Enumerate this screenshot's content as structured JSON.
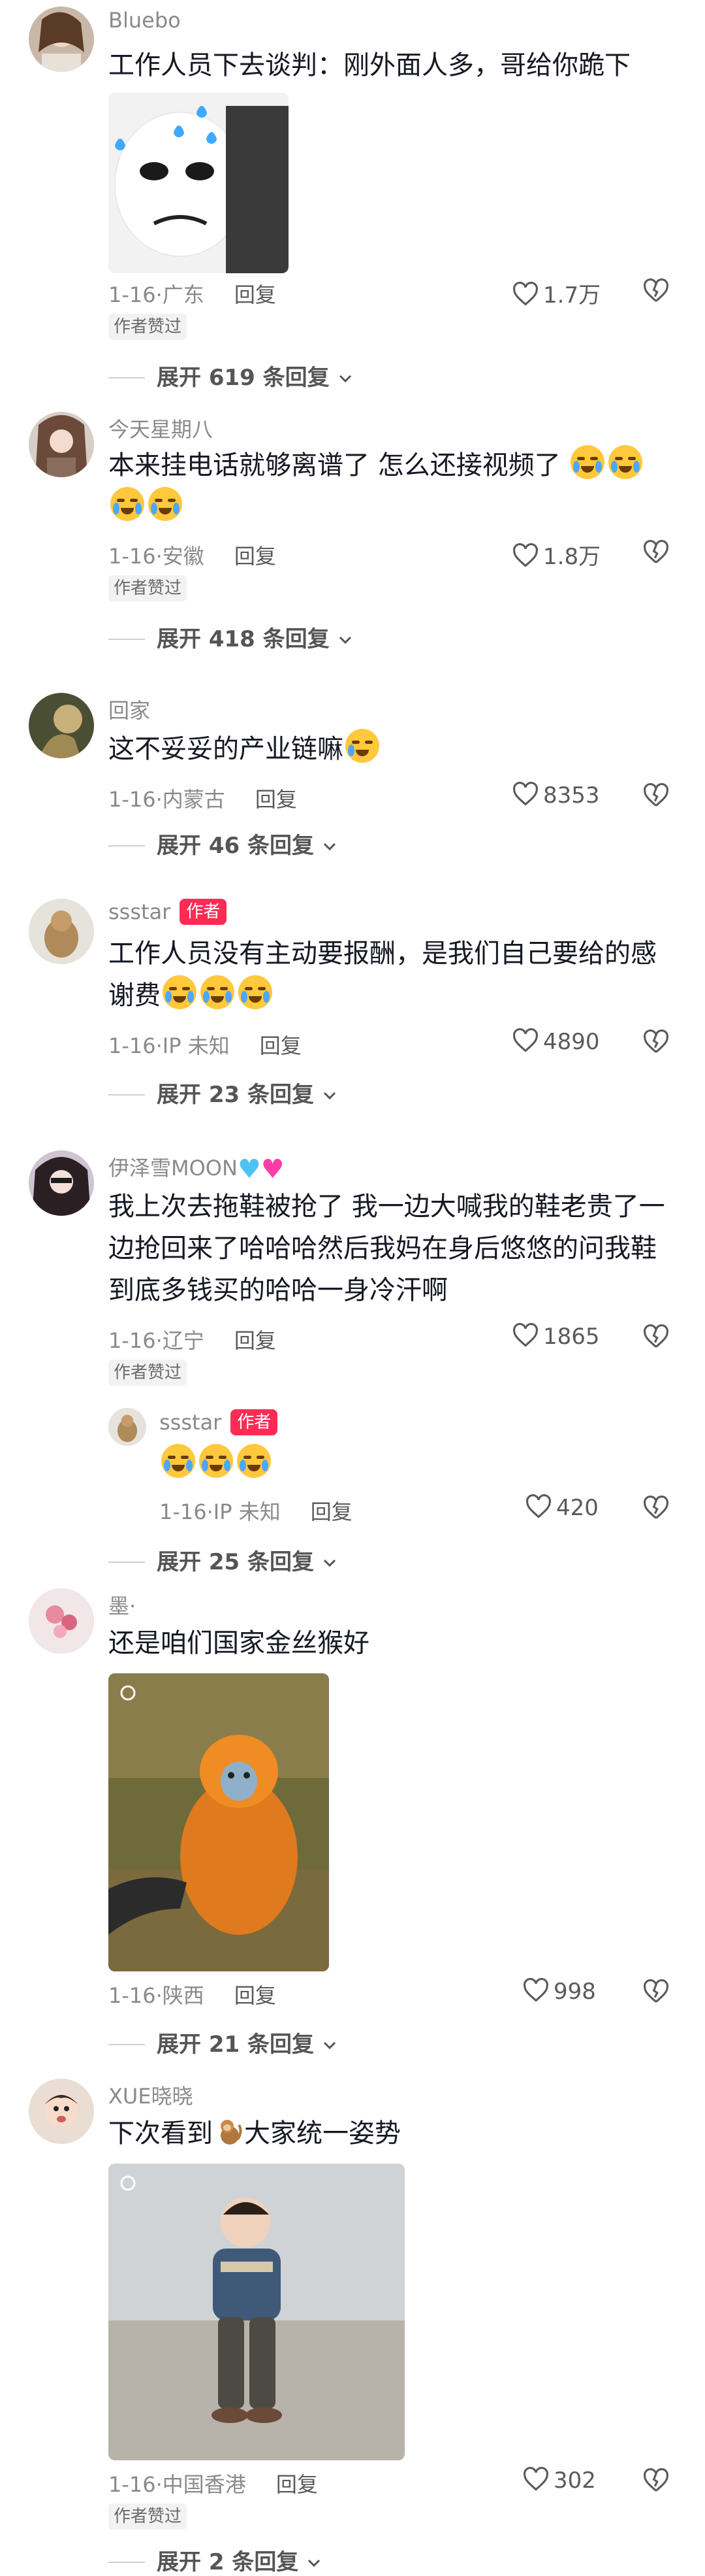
{
  "comments": [
    {
      "username": "Bluebo",
      "text": "工作人员下去谈判：刚外面人多，哥给你跪下",
      "meta_date": "1-16",
      "meta_loc": "广东",
      "reply_label": "回复",
      "likes": "1.7万",
      "badge": "作者赞过",
      "expand": "展开 619 条回复"
    },
    {
      "username": "今天星期八",
      "text": "本来挂电话就够离谱了 怎么还接视频了",
      "meta_date": "1-16",
      "meta_loc": "安徽",
      "reply_label": "回复",
      "likes": "1.8万",
      "badge": "作者赞过",
      "expand": "展开 418 条回复"
    },
    {
      "username": "回家",
      "text": "这不妥妥的产业链嘛",
      "meta_date": "1-16",
      "meta_loc": "内蒙古",
      "reply_label": "回复",
      "likes": "8353",
      "expand": "展开 46 条回复"
    },
    {
      "username": "ssstar",
      "author_tag": "作者",
      "text": "工作人员没有主动要报酬，是我们自己要给的感谢费",
      "meta_date": "1-16",
      "meta_loc": "IP 未知",
      "reply_label": "回复",
      "likes": "4890",
      "expand": "展开 23 条回复"
    },
    {
      "username": "伊泽雪MOON",
      "text": "我上次去拖鞋被抢了 我一边大喊我的鞋老贵了一边抢回来了哈哈哈然后我妈在身后悠悠的问我鞋到底多钱买的哈哈一身冷汗啊",
      "meta_date": "1-16",
      "meta_loc": "辽宁",
      "reply_label": "回复",
      "likes": "1865",
      "badge": "作者赞过",
      "reply": {
        "username": "ssstar",
        "author_tag": "作者",
        "meta_date": "1-16",
        "meta_loc": "IP 未知",
        "reply_label": "回复",
        "likes": "420"
      },
      "expand": "展开 25 条回复"
    },
    {
      "username": "墨·",
      "text": "还是咱们国家金丝猴好",
      "meta_date": "1-16",
      "meta_loc": "陕西",
      "reply_label": "回复",
      "likes": "998",
      "expand": "展开 21 条回复"
    },
    {
      "username": "XUE晓晓",
      "text_before": "下次看到",
      "text_after": "大家统一姿势",
      "meta_date": "1-16",
      "meta_loc": "中国香港",
      "reply_label": "回复",
      "likes": "302",
      "badge": "作者赞过",
      "expand": "展开 2 条回复"
    }
  ],
  "separator": "·",
  "icons": {
    "like": "heart-outline-icon",
    "dislike": "broken-heart-icon",
    "expand": "chevron-down-icon"
  },
  "colors": {
    "author_tag": "#fe2c55",
    "muted_text": "#8a8a8a",
    "body_text": "#161823"
  }
}
